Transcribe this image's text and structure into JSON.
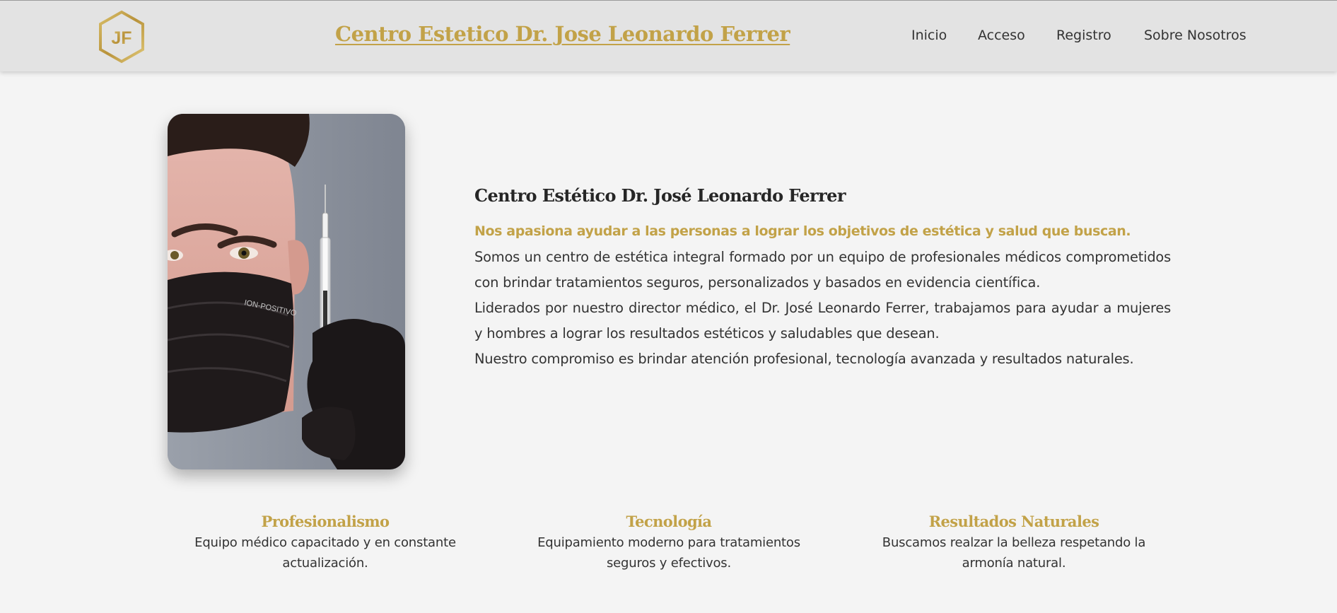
{
  "header": {
    "logo_text": "JF",
    "site_title": "Centro Estetico Dr. Jose Leonardo Ferrer",
    "nav": [
      {
        "label": "Inicio"
      },
      {
        "label": "Acceso"
      },
      {
        "label": "Registro"
      },
      {
        "label": "Sobre Nosotros"
      }
    ]
  },
  "about": {
    "title": "Centro Estético Dr. José Leonardo Ferrer",
    "lead": "Nos apasiona ayudar a las personas a lograr los objetivos de estética y salud que buscan.",
    "paragraphs": [
      "Somos un centro de estética integral formado por un equipo de profesionales médicos comprometidos con brindar tratamientos seguros, personalizados y basados en evidencia científica.",
      "Liderados por nuestro director médico, el Dr. José Leonardo Ferrer, trabajamos para ayudar a mujeres y hombres a lograr los resultados estéticos y saludables que desean.",
      "Nuestro compromiso es brindar atención profesional, tecnología avanzada y resultados naturales."
    ],
    "photo_mask_text": "ION-POSITIVO"
  },
  "features": [
    {
      "title": "Profesionalismo",
      "text": "Equipo médico capacitado y en constante actualización."
    },
    {
      "title": "Tecnología",
      "text": "Equipamiento moderno para tratamientos seguros y efectivos."
    },
    {
      "title": "Resultados Naturales",
      "text": "Buscamos realzar la belleza respetando la armonía natural."
    }
  ],
  "colors": {
    "accent_gold": "#c2a248",
    "header_bg": "#e3e3e3",
    "page_bg": "#f4f4f4",
    "text_dark": "#333333"
  },
  "icons": {
    "logo": "hexagon-monogram-logo"
  }
}
